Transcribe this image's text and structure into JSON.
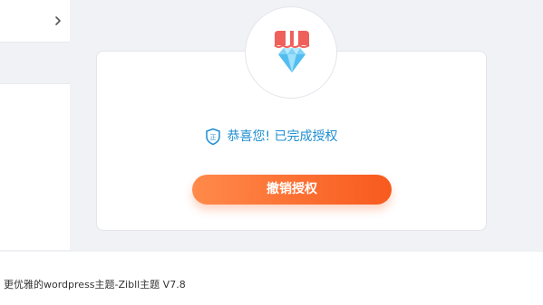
{
  "sidebar": {
    "expand_icon": "chevron-right-icon"
  },
  "auth_card": {
    "badge_icon": "diamond-icon",
    "status_icon": "shield-icon",
    "status_text": "恭喜您! 已完成授权",
    "revoke_button_label": "撤销授权"
  },
  "footer": {
    "text": "更优雅的wordpress主题-Zibll主题 V7.8"
  },
  "colors": {
    "status_blue": "#1f8fd1",
    "button_gradient_start": "#ff8a4a",
    "button_gradient_end": "#f85a1e",
    "page_background": "#f1f2f6"
  }
}
